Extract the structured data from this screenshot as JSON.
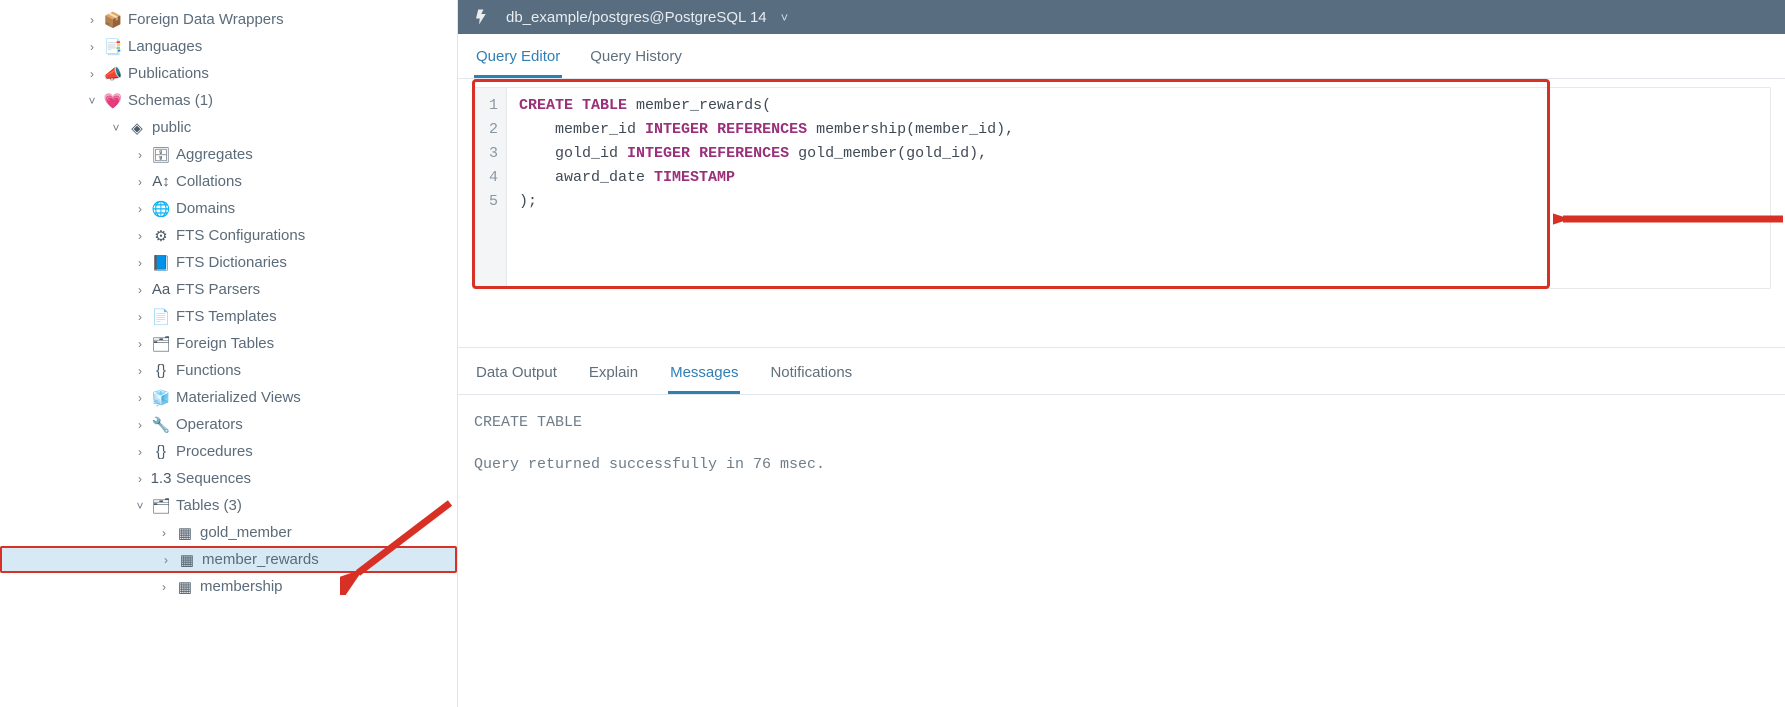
{
  "sidebar": {
    "items": [
      {
        "indent": 80,
        "chev": "›",
        "icon": "📦",
        "label": "Foreign Data Wrappers"
      },
      {
        "indent": 80,
        "chev": "›",
        "icon": "📑",
        "label": "Languages"
      },
      {
        "indent": 80,
        "chev": "›",
        "icon": "📣",
        "label": "Publications"
      },
      {
        "indent": 80,
        "chev": "˅",
        "icon": "💗",
        "label": "Schemas (1)"
      },
      {
        "indent": 104,
        "chev": "˅",
        "icon": "◈",
        "label": "public"
      },
      {
        "indent": 128,
        "chev": "›",
        "icon": "🗄",
        "label": "Aggregates"
      },
      {
        "indent": 128,
        "chev": "›",
        "icon": "A↕",
        "label": "Collations"
      },
      {
        "indent": 128,
        "chev": "›",
        "icon": "🌐",
        "label": "Domains"
      },
      {
        "indent": 128,
        "chev": "›",
        "icon": "⚙",
        "label": "FTS Configurations"
      },
      {
        "indent": 128,
        "chev": "›",
        "icon": "📘",
        "label": "FTS Dictionaries"
      },
      {
        "indent": 128,
        "chev": "›",
        "icon": "Aa",
        "label": "FTS Parsers"
      },
      {
        "indent": 128,
        "chev": "›",
        "icon": "📄",
        "label": "FTS Templates"
      },
      {
        "indent": 128,
        "chev": "›",
        "icon": "🗂",
        "label": "Foreign Tables"
      },
      {
        "indent": 128,
        "chev": "›",
        "icon": "{}",
        "label": "Functions"
      },
      {
        "indent": 128,
        "chev": "›",
        "icon": "🧊",
        "label": "Materialized Views"
      },
      {
        "indent": 128,
        "chev": "›",
        "icon": "🔧",
        "label": "Operators"
      },
      {
        "indent": 128,
        "chev": "›",
        "icon": "{}",
        "label": "Procedures"
      },
      {
        "indent": 128,
        "chev": "›",
        "icon": "1.3",
        "label": "Sequences"
      },
      {
        "indent": 128,
        "chev": "˅",
        "icon": "🗂",
        "label": "Tables (3)"
      },
      {
        "indent": 152,
        "chev": "›",
        "icon": "▦",
        "label": "gold_member"
      },
      {
        "indent": 152,
        "chev": "›",
        "icon": "▦",
        "label": "member_rewards",
        "selected": true
      },
      {
        "indent": 152,
        "chev": "›",
        "icon": "▦",
        "label": "membership"
      }
    ]
  },
  "titlebar": {
    "title": "db_example/postgres@PostgreSQL 14"
  },
  "tabs": {
    "editor": "Query Editor",
    "history": "Query History"
  },
  "sql": {
    "lines": [
      "1",
      "2",
      "3",
      "4",
      "5"
    ],
    "code": [
      {
        "t": "kw",
        "v": "CREATE TABLE"
      },
      {
        "t": "sp"
      },
      {
        "t": "idf",
        "v": "member_rewards("
      },
      {
        "t": "nl"
      },
      {
        "t": "pad",
        "v": "    "
      },
      {
        "t": "idf",
        "v": "member_id "
      },
      {
        "t": "ty",
        "v": "INTEGER"
      },
      {
        "t": "sp"
      },
      {
        "t": "kw2",
        "v": "REFERENCES"
      },
      {
        "t": "sp"
      },
      {
        "t": "idf",
        "v": "membership(member_id),"
      },
      {
        "t": "nl"
      },
      {
        "t": "pad",
        "v": "    "
      },
      {
        "t": "idf",
        "v": "gold_id "
      },
      {
        "t": "ty",
        "v": "INTEGER"
      },
      {
        "t": "sp"
      },
      {
        "t": "kw2",
        "v": "REFERENCES"
      },
      {
        "t": "sp"
      },
      {
        "t": "idf",
        "v": "gold_member(gold_id),"
      },
      {
        "t": "nl"
      },
      {
        "t": "pad",
        "v": "    "
      },
      {
        "t": "idf",
        "v": "award_date "
      },
      {
        "t": "ty",
        "v": "TIMESTAMP"
      },
      {
        "t": "nl"
      },
      {
        "t": "idf",
        "v": ");"
      }
    ]
  },
  "outTabs": {
    "data": "Data Output",
    "explain": "Explain",
    "messages": "Messages",
    "notif": "Notifications"
  },
  "output": {
    "line1": "CREATE TABLE",
    "line2": "Query returned successfully in 76 msec."
  }
}
